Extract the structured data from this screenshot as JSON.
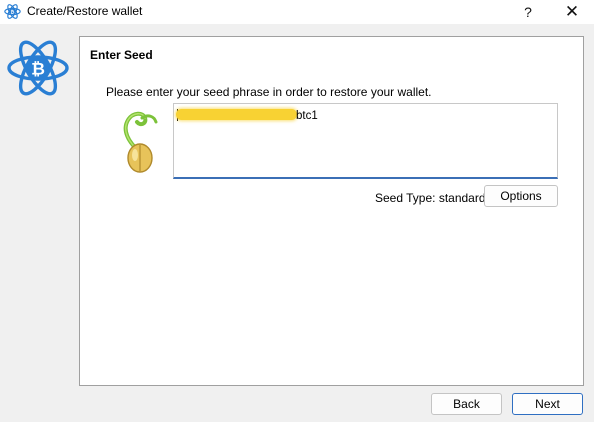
{
  "window": {
    "title": "Create/Restore wallet",
    "help_label": "?",
    "close_label": "✕"
  },
  "page": {
    "heading": "Enter Seed",
    "instruction": "Please enter your seed phrase in order to restore your wallet.",
    "seed_input": {
      "visible_text": "btc1",
      "redacted": true
    },
    "seed_type_label": "Seed Type: standard",
    "options_label": "Options"
  },
  "footer": {
    "back_label": "Back",
    "next_label": "Next"
  },
  "colors": {
    "accent": "#3b6fb6",
    "logo_blue": "#2a7fd4",
    "redaction": "#f8d233"
  },
  "icons": {
    "app": "electrum-bitcoin-icon",
    "logo": "electrum-bitcoin-logo",
    "seed": "sprouting-seed-icon"
  }
}
